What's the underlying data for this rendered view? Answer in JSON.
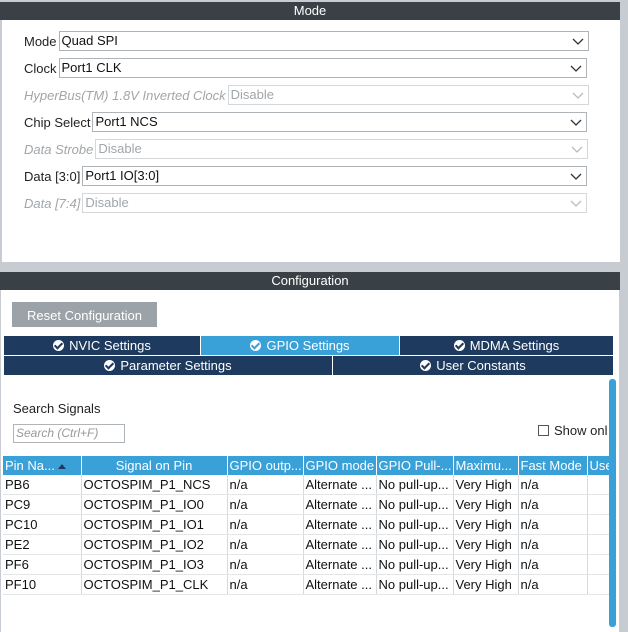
{
  "mode_header": "Mode",
  "config_header": "Configuration",
  "mode_fields": [
    {
      "label": "Mode",
      "value": "Quad SPI",
      "disabled": false
    },
    {
      "label": "Clock",
      "value": "Port1 CLK",
      "disabled": false
    },
    {
      "label": "HyperBus(TM) 1.8V Inverted Clock",
      "value": "Disable",
      "disabled": true
    },
    {
      "label": "Chip Select",
      "value": "Port1 NCS",
      "disabled": false
    },
    {
      "label": "Data Strobe",
      "value": "Disable",
      "disabled": true
    },
    {
      "label": "Data [3:0]",
      "value": "Port1 IO[3:0]",
      "disabled": false
    },
    {
      "label": "Data [7:4]",
      "value": "Disable",
      "disabled": true
    }
  ],
  "reset_button": "Reset Configuration",
  "tabs": [
    {
      "label": "NVIC Settings",
      "active": false
    },
    {
      "label": "GPIO Settings",
      "active": true
    },
    {
      "label": "MDMA Settings",
      "active": false
    },
    {
      "label": "Parameter Settings",
      "active": false
    },
    {
      "label": "User Constants",
      "active": false
    }
  ],
  "search": {
    "label": "Search Signals",
    "placeholder": "Search (Ctrl+F)"
  },
  "show_only_label": "Show onl",
  "table": {
    "headers": [
      "Pin Na...",
      "Signal on Pin",
      "GPIO outp...",
      "GPIO mode",
      "GPIO Pull-...",
      "Maximu...",
      "Fast Mode",
      "Use"
    ],
    "rows": [
      [
        "PB6",
        "OCTOSPIM_P1_NCS",
        "n/a",
        "Alternate ...",
        "No pull-up...",
        "Very High",
        "n/a",
        ""
      ],
      [
        "PC9",
        "OCTOSPIM_P1_IO0",
        "n/a",
        "Alternate ...",
        "No pull-up...",
        "Very High",
        "n/a",
        ""
      ],
      [
        "PC10",
        "OCTOSPIM_P1_IO1",
        "n/a",
        "Alternate ...",
        "No pull-up...",
        "Very High",
        "n/a",
        ""
      ],
      [
        "PE2",
        "OCTOSPIM_P1_IO2",
        "n/a",
        "Alternate ...",
        "No pull-up...",
        "Very High",
        "n/a",
        ""
      ],
      [
        "PF6",
        "OCTOSPIM_P1_IO3",
        "n/a",
        "Alternate ...",
        "No pull-up...",
        "Very High",
        "n/a",
        ""
      ],
      [
        "PF10",
        "OCTOSPIM_P1_CLK",
        "n/a",
        "Alternate ...",
        "No pull-up...",
        "Very High",
        "n/a",
        ""
      ]
    ]
  },
  "colors": {
    "header_bg": "#394146",
    "tab_bg": "#1e3a5f",
    "tab_active": "#3aa1d8",
    "table_header": "#3aa1d8"
  }
}
